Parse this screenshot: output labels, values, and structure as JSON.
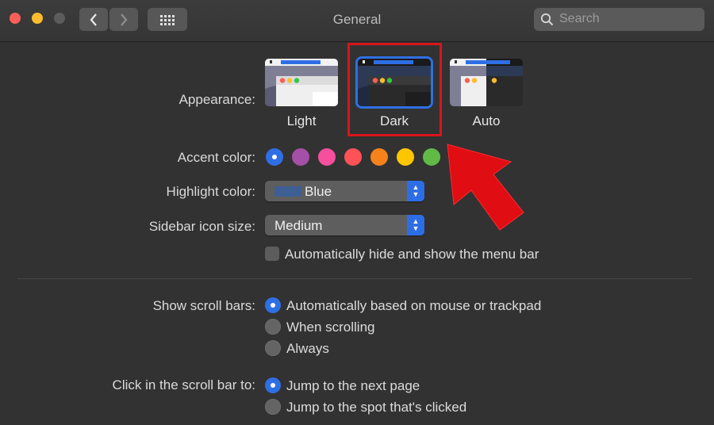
{
  "window": {
    "title": "General"
  },
  "toolbar": {
    "back_icon": "chevron-left-icon",
    "forward_icon": "chevron-right-icon",
    "grid_icon": "grid-icon"
  },
  "search": {
    "placeholder": "Search"
  },
  "appearance": {
    "label": "Appearance:",
    "options": [
      {
        "label": "Light",
        "selected": false
      },
      {
        "label": "Dark",
        "selected": true
      },
      {
        "label": "Auto",
        "selected": false
      }
    ]
  },
  "accent": {
    "label": "Accent color:",
    "colors": [
      "#2f6fe4",
      "#a550a7",
      "#f74f9e",
      "#ff5257",
      "#f7821b",
      "#ffc600",
      "#62ba46"
    ],
    "selected_index": 0
  },
  "highlight": {
    "label": "Highlight color:",
    "value": "Blue",
    "swatch_color": "#3d5f94"
  },
  "sidebar": {
    "label": "Sidebar icon size:",
    "value": "Medium"
  },
  "menubar": {
    "label": "Automatically hide and show the menu bar",
    "checked": false
  },
  "scrollbars": {
    "label": "Show scroll bars:",
    "options": [
      {
        "label": "Automatically based on mouse or trackpad",
        "selected": true
      },
      {
        "label": "When scrolling",
        "selected": false
      },
      {
        "label": "Always",
        "selected": false
      }
    ]
  },
  "click": {
    "label": "Click in the scroll bar to:",
    "options": [
      {
        "label": "Jump to the next page",
        "selected": true
      },
      {
        "label": "Jump to the spot that's clicked",
        "selected": false
      }
    ]
  },
  "colors": {
    "annotation_red": "#e00d12",
    "accent_blue": "#2f6fe4"
  }
}
